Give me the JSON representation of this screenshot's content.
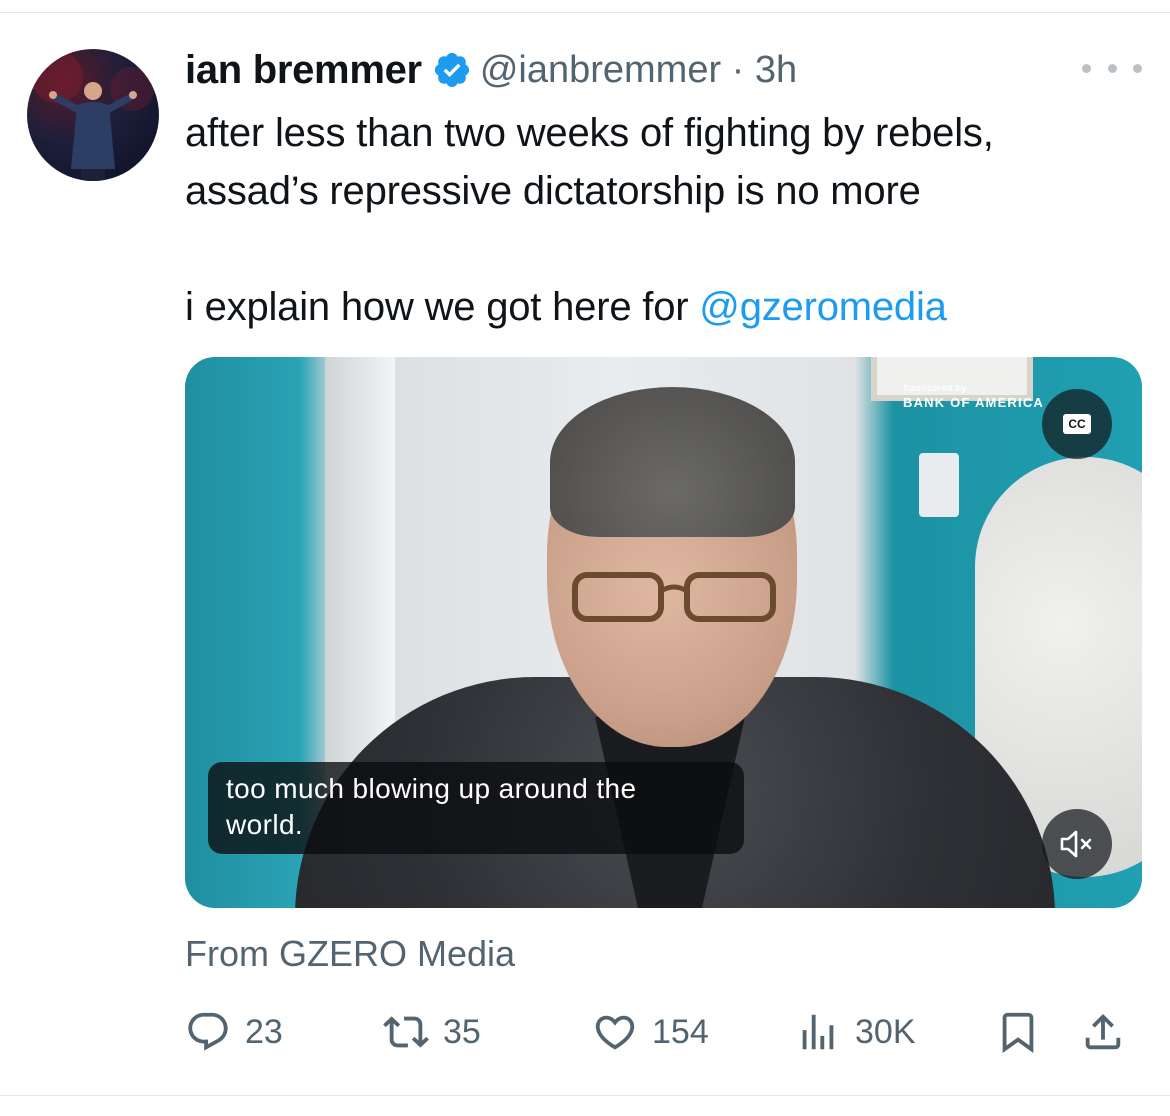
{
  "tweet": {
    "author_name": "ian bremmer",
    "handle_time": "@ianbremmer · 3h",
    "text_line1": "after less than two weeks of fighting by rebels,",
    "text_line2": "assad’s repressive dictatorship is no more",
    "text_line3_prefix": "i explain how we got here for ",
    "mention": "@gzeromedia",
    "source": "From GZERO Media"
  },
  "video": {
    "sponsor_small": "Sponsored by",
    "sponsor_brand": "BANK OF AMERICA",
    "cc_label": "CC",
    "caption_line1": "too much blowing up around the",
    "caption_line2": "world."
  },
  "stats": {
    "replies": "23",
    "retweets": "35",
    "likes": "154",
    "views": "30K"
  },
  "colors": {
    "link": "#1d9bf0",
    "secondary_text": "#536471",
    "verified_badge": "#1d9bf0"
  },
  "icons": {
    "verified": "verified-badge-icon",
    "more": "more-options-icon",
    "reply": "reply-icon",
    "retweet": "retweet-icon",
    "like": "heart-icon",
    "views": "views-chart-icon",
    "bookmark": "bookmark-icon",
    "share": "share-icon",
    "captions": "captions-icon",
    "mute": "speaker-muted-icon"
  }
}
